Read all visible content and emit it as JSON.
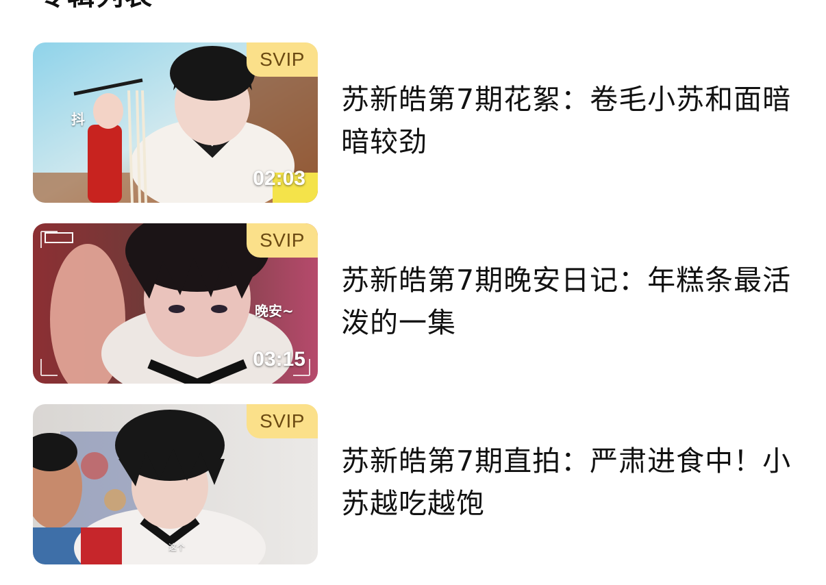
{
  "header": {
    "title": "专辑列表",
    "chevron_icon": "chevron-down-icon"
  },
  "videos": [
    {
      "title": "苏新皓第7期花絮：卷毛小苏和面暗暗较劲",
      "badge": "SVIP",
      "duration": "02:03",
      "thumb_caption": "抖"
    },
    {
      "title": "苏新皓第7期晚安日记：年糕条最活泼的一集",
      "badge": "SVIP",
      "duration": "03:15",
      "thumb_caption": "晚安~"
    },
    {
      "title": "苏新皓第7期直拍：严肃进食中！小苏越吃越饱",
      "badge": "SVIP",
      "duration": "",
      "thumb_caption": "这个"
    }
  ],
  "colors": {
    "svip_badge_bg": "#fbe08a",
    "svip_badge_text": "#6b4a12",
    "title_text": "#111111",
    "background": "#ffffff"
  }
}
